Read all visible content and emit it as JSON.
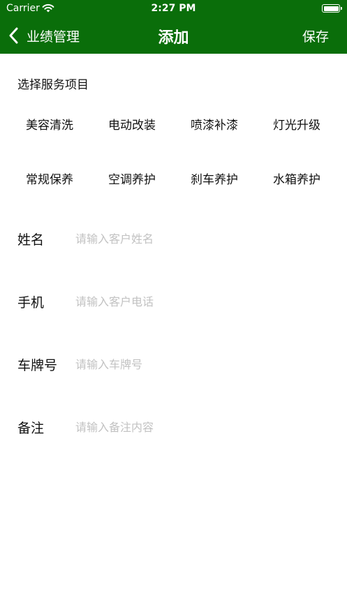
{
  "status_bar": {
    "carrier": "Carrier",
    "time": "2:27 PM"
  },
  "nav": {
    "back_label": "业绩管理",
    "title": "添加",
    "save_label": "保存"
  },
  "services": {
    "section_title": "选择服务项目",
    "items": [
      {
        "label": "美容清洗"
      },
      {
        "label": "电动改装"
      },
      {
        "label": "喷漆补漆"
      },
      {
        "label": "灯光升级"
      },
      {
        "label": "常规保养"
      },
      {
        "label": "空调养护"
      },
      {
        "label": "刹车养护"
      },
      {
        "label": "水箱养护"
      }
    ]
  },
  "form": {
    "name": {
      "label": "姓名",
      "placeholder": "请输入客户姓名",
      "value": ""
    },
    "phone": {
      "label": "手机",
      "placeholder": "请输入客户电话",
      "value": ""
    },
    "plate": {
      "label": "车牌号",
      "placeholder": "请输入车牌号",
      "value": ""
    },
    "note": {
      "label": "备注",
      "placeholder": "请输入备注内容",
      "value": ""
    }
  },
  "colors": {
    "header_bg": "#0a6e0a",
    "header_text": "#ffffff",
    "placeholder": "#c2c2c2"
  },
  "icons": {
    "back": "chevron-left-icon",
    "wifi": "wifi-icon",
    "battery": "battery-icon"
  }
}
